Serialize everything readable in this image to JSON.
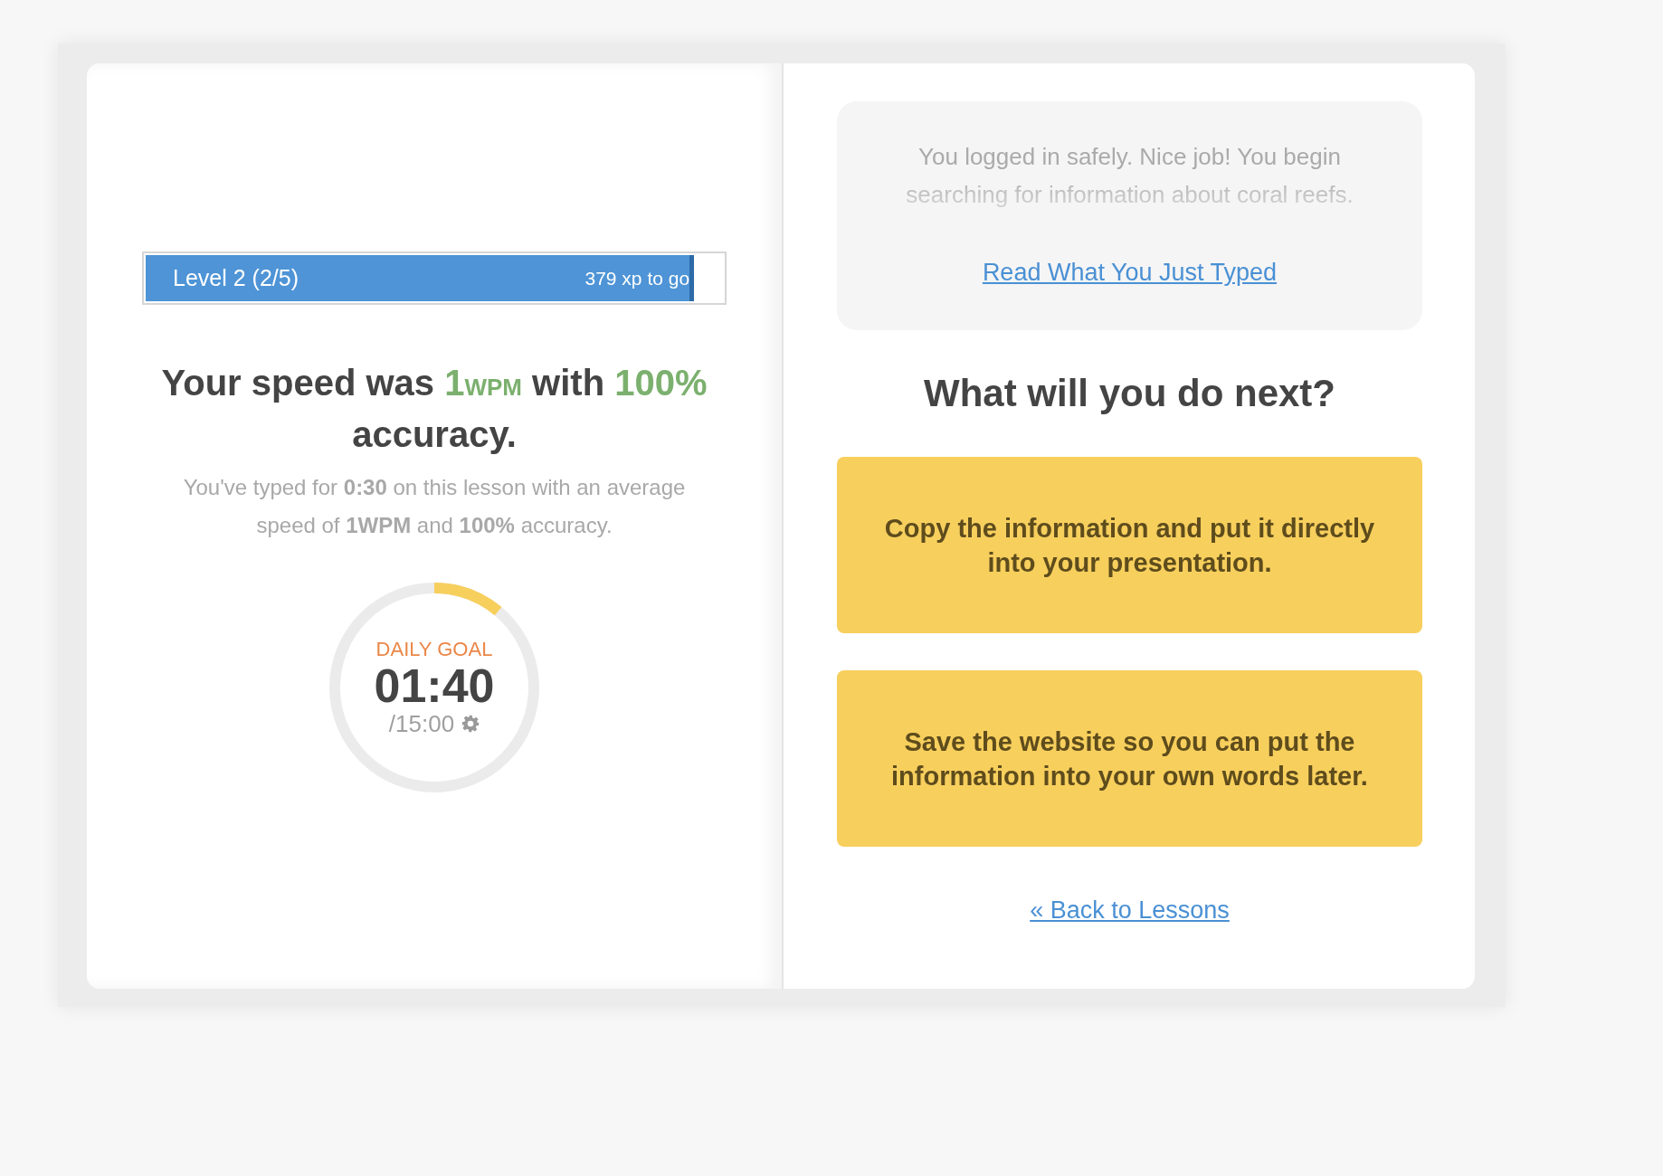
{
  "level_bar": {
    "label": "Level 2 (2/5)",
    "remaining": "379 xp to go",
    "level": 0.95
  },
  "result": {
    "prefix": "Your speed was",
    "speed": "1",
    "unit": "WPM",
    "middle": "with",
    "accuracy": "100%",
    "suffix": "accuracy."
  },
  "summary": "You've typed for **0:30** on this lesson with an average speed of **1WPM** and **100%** accuracy.",
  "daily_goal": {
    "label": "DAILY GOAL",
    "time": "01:40",
    "target": "/15:00"
  },
  "passage": {
    "text": "You logged in safely. Nice job! You begin searching for information about coral reefs.",
    "link": "Read What You Just Typed"
  },
  "question": "What will you do next?",
  "choices": [
    "Copy the information and put it directly into your presentation.",
    "Save the website so you can put the information into your own words later."
  ],
  "back_link": "« Back to Lessons"
}
